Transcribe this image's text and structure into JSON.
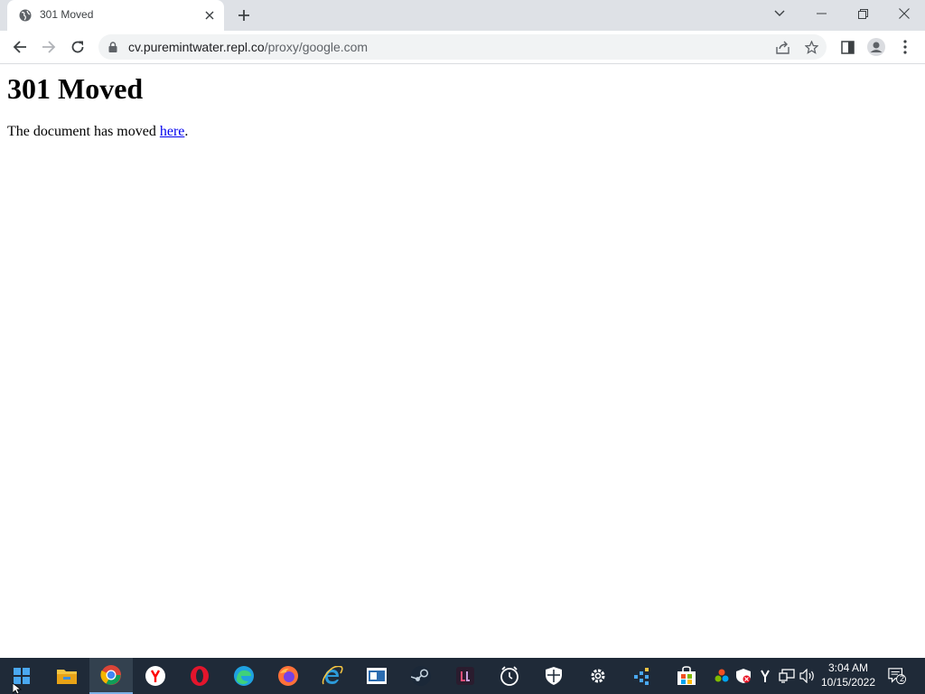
{
  "browser": {
    "tab": {
      "title": "301 Moved",
      "favicon": "globe-icon",
      "close_icon": "close-icon"
    },
    "new_tab_icon": "plus-icon",
    "window_controls": [
      "chevron-down-icon",
      "minimize-icon",
      "restore-icon",
      "close-icon"
    ],
    "toolbar": {
      "back_icon": "back-arrow-icon",
      "forward_icon": "forward-arrow-icon",
      "reload_icon": "reload-icon",
      "address": {
        "lock_icon": "lock-icon",
        "host": "cv.puremintwater.repl.co",
        "path": "/proxy/google.com"
      },
      "right_icons": [
        "share-icon",
        "star-icon",
        "side-panel-icon",
        "profile-icon",
        "menu-icon"
      ]
    }
  },
  "page": {
    "heading": "301 Moved",
    "text_before_link": "The document has moved ",
    "link_text": "here",
    "text_after_link": "."
  },
  "taskbar": {
    "apps": [
      "start-icon",
      "file-explorer-icon",
      "chrome-icon",
      "yandex-icon",
      "opera-icon",
      "edge-icon",
      "firefox-icon",
      "ie-icon",
      "app-icon",
      "steam-icon",
      "lens-icon",
      "clock-app-icon",
      "security-icon",
      "settings-icon",
      "dots-app-icon",
      "store-icon"
    ],
    "active_app": "chrome-icon",
    "tray_icons": [
      "color-icon",
      "shield-tray-icon",
      "yandex-tray-icon",
      "network-icon",
      "volume-icon"
    ],
    "time": "3:04 AM",
    "date": "10/15/2022",
    "notification_count": "2",
    "colors": {
      "taskbar_bg": "#1f2a38",
      "accent": "#7cb1e6",
      "link": "#0000ee"
    }
  }
}
